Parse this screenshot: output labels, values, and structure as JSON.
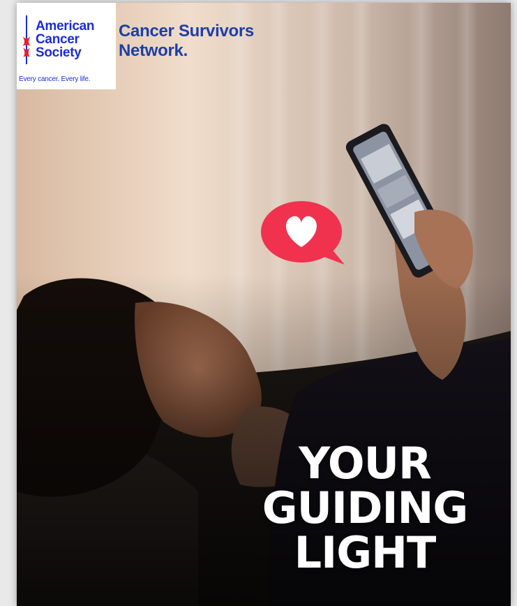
{
  "logo": {
    "org_line_1": "American",
    "org_line_2": "Cancer",
    "org_line_3": "Society",
    "tagline": "Every cancer. Every life.",
    "network_line_1": "Cancer Survivors",
    "network_line_2": "Network."
  },
  "headline": {
    "line_1": "YOUR",
    "line_2": "GUIDING",
    "line_3": "LIGHT"
  },
  "colors": {
    "brand_blue": "#1c2cd6",
    "network_blue": "#1c3ea8",
    "heart_bubble": "#f0324f",
    "flag_red": "#e8202c"
  },
  "icons": {
    "heart_bubble": "heart-speech-bubble-icon",
    "acs_flag": "acs-sword-flag-icon"
  }
}
